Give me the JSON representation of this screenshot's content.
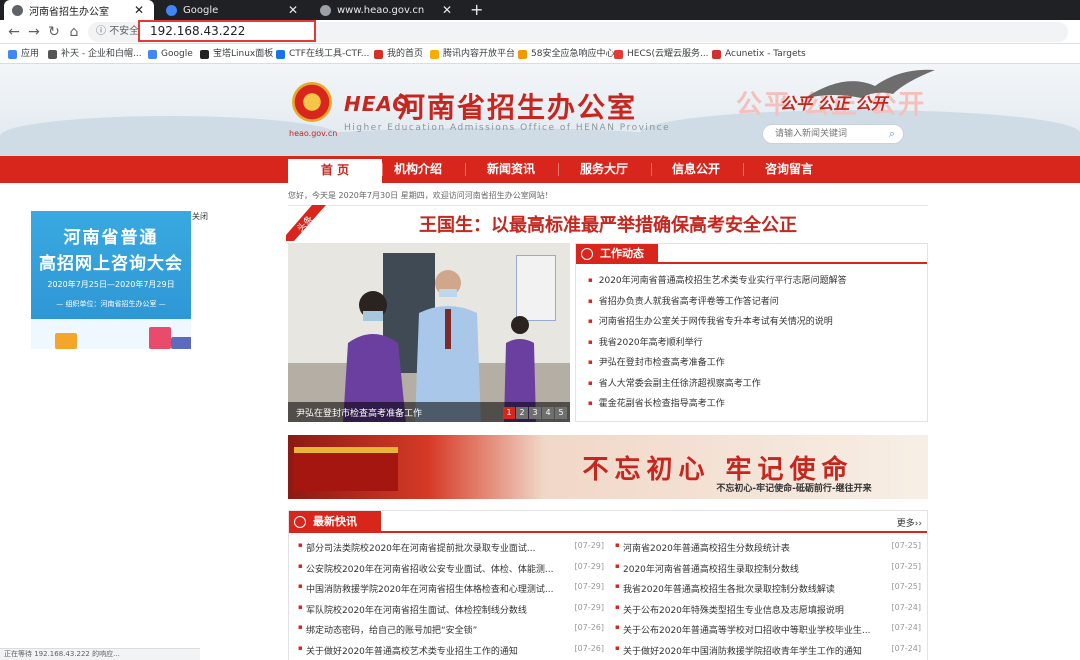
{
  "browser": {
    "tabs": [
      {
        "title": "河南省招生办公室",
        "active": true,
        "favicon_color": "#5f6368"
      },
      {
        "title": "Google",
        "active": false,
        "favicon_color": "#4285f4"
      },
      {
        "title": "www.heao.gov.cn",
        "active": false,
        "favicon_color": "#9aa0a6"
      }
    ],
    "new_tab": "+",
    "security_label": "不安全",
    "url": "192.168.43.222",
    "bookmarks": [
      {
        "label": "应用",
        "icon": "apps-grid-icon",
        "color": "#4285f4"
      },
      {
        "label": "补天 - 企业和白帽...",
        "icon": "butian-icon",
        "color": "#555555"
      },
      {
        "label": "Google",
        "icon": "google-icon",
        "color": "#4285f4"
      },
      {
        "label": "宝塔Linux面板",
        "icon": "bt-panel-icon",
        "color": "#222222"
      },
      {
        "label": "CTF在线工具-CTF...",
        "icon": "ctf-tool-icon",
        "color": "#1a73e8"
      },
      {
        "label": "我的首页",
        "icon": "homepage-icon",
        "color": "#d93025"
      },
      {
        "label": "腾讯内容开放平台",
        "icon": "tencent-icon",
        "color": "#f9ab00"
      },
      {
        "label": "58安全应急响应中心",
        "icon": "src58-icon",
        "color": "#f29900"
      },
      {
        "label": "HECS(云耀云服务...",
        "icon": "huawei-icon",
        "color": "#e53935"
      },
      {
        "label": "Acunetix - Targets",
        "icon": "acunetix-icon",
        "color": "#d32f2f"
      }
    ],
    "status_text": "正在等待 192.168.43.222 的响应..."
  },
  "header": {
    "domain_tag": "heao.gov.cn",
    "brand_mark": "HEAO",
    "site_name": "河南省招生办公室",
    "site_name_en": "Higher Education Admissions Office of HENAN Province",
    "slogan": "公平 公正 公开",
    "search_placeholder": "请输入新闻关键词"
  },
  "nav": [
    "首 页",
    "机构介绍",
    "新闻资讯",
    "服务大厅",
    "信息公开",
    "咨询留言"
  ],
  "notice": "您好，今天是 2020年7月30日 星期四，欢迎访问河南省招生办公室网站！",
  "ad": {
    "line1": "河南省普通",
    "line2": "高招网上咨询大会",
    "dates": "2020年7月25日—2020年7月29日",
    "organizer": "— 组织单位：河南省招生办公室 —",
    "close": "关闭"
  },
  "headline": {
    "badge": "头条",
    "title": "王国生：以最高标准最严举措确保高考安全公正"
  },
  "slider": {
    "caption": "尹弘在登封市检查高考准备工作",
    "pages": [
      "1",
      "2",
      "3",
      "4",
      "5"
    ],
    "current_page": 1
  },
  "work_news": {
    "title": "工作动态",
    "items": [
      "2020年河南省普通高校招生艺术类专业实行平行志愿问题解答",
      "省招办负责人就我省高考评卷等工作答记者问",
      "河南省招生办公室关于网传我省专升本考试有关情况的说明",
      "我省2020年高考顺利举行",
      "尹弘在登封市检查高考准备工作",
      "省人大常委会副主任徐济超视察高考工作",
      "霍金花副省长检查指导高考工作"
    ]
  },
  "promo_banner": {
    "title": "不忘初心  牢记使命",
    "subtitle": "不忘初心-牢记使命-砥砺前行-继往开来"
  },
  "latest_news": {
    "title": "最新快讯",
    "more": "更多››",
    "left": [
      {
        "text": "部分司法类院校2020年在河南省提前批次录取专业面试...",
        "date": "[07-29]"
      },
      {
        "text": "公安院校2020年在河南省招收公安专业面试、体检、体能测...",
        "date": "[07-29]"
      },
      {
        "text": "中国消防救援学院2020年在河南省招生体格检查和心理测试...",
        "date": "[07-29]"
      },
      {
        "text": "军队院校2020年在河南省招生面试、体检控制线分数线",
        "date": "[07-29]"
      },
      {
        "text": "绑定动态密码，给自己的账号加把“安全锁”",
        "date": "[07-26]"
      },
      {
        "text": "关于做好2020年普通高校艺术类专业招生工作的通知",
        "date": "[07-26]"
      }
    ],
    "right": [
      {
        "text": "河南省2020年普通高校招生分数段统计表",
        "date": "[07-25]"
      },
      {
        "text": "2020年河南省普通高校招生录取控制分数线",
        "date": "[07-25]"
      },
      {
        "text": "我省2020年普通高校招生各批次录取控制分数线解读",
        "date": "[07-25]"
      },
      {
        "text": "关于公布2020年特殊类型招生专业信息及志愿填报说明",
        "date": "[07-24]"
      },
      {
        "text": "关于公布2020年普通高等学校对口招收中等职业学校毕业生...",
        "date": "[07-24]"
      },
      {
        "text": "关于做好2020年中国消防救援学院招收青年学生工作的通知",
        "date": "[07-24]"
      }
    ]
  },
  "colors": {
    "brand_red": "#d9261c",
    "title_red": "#c6261e",
    "url_highlight": "#e53935"
  }
}
